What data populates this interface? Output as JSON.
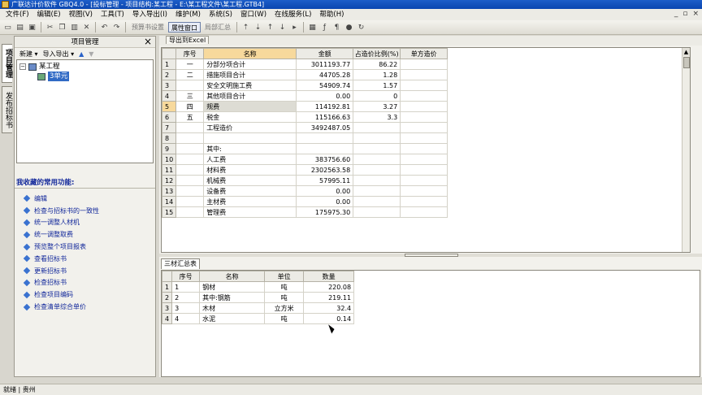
{
  "window": {
    "title": "广联达计价软件 GBQ4.0 - [投标管理 - 项目结构:某工程 - E:\\某工程文件\\某工程.GTB4]"
  },
  "menu": [
    "文件(F)",
    "编辑(E)",
    "视图(V)",
    "工具(T)",
    "导入导出(I)",
    "维护(M)",
    "系统(S)",
    "窗口(W)",
    "在线服务(L)",
    "帮助(H)"
  ],
  "toolbar": {
    "calc_settings": "预算书设置",
    "property_window": "属性窗口",
    "local_summary": "局部汇总"
  },
  "side_tabs": [
    "项目管理",
    "发布招标书"
  ],
  "left_panel": {
    "title": "项目管理",
    "tools": [
      "新建 ▾",
      "导入导出 ▾"
    ],
    "tree": {
      "root": "某工程",
      "child": "3单元"
    },
    "favorites_title": "我收藏的常用功能:",
    "favorites": [
      "编辑",
      "检查与招标书的一致性",
      "统一调整人材机",
      "统一调整取费",
      "预览整个项目报表",
      "查看招标书",
      "更新招标书",
      "检查招标书",
      "检查项目编码",
      "检查清单综合单价"
    ]
  },
  "main": {
    "export_tab": "导出到Excel",
    "top_headers": [
      "序号",
      "名称",
      "金额",
      "占造价比例(%)",
      "单方造价"
    ],
    "top_rows": [
      [
        "1",
        "一",
        "分部分项合计",
        "3011193.77",
        "86.22",
        ""
      ],
      [
        "2",
        "二",
        "措施项目合计",
        "44705.28",
        "1.28",
        ""
      ],
      [
        "3",
        "",
        "安全文明施工费",
        "54909.74",
        "1.57",
        ""
      ],
      [
        "4",
        "三",
        "其他项目合计",
        "0.00",
        "0",
        ""
      ],
      [
        "5",
        "四",
        "规费",
        "114192.81",
        "3.27",
        ""
      ],
      [
        "6",
        "五",
        "税金",
        "115166.63",
        "3.3",
        ""
      ],
      [
        "7",
        "",
        "工程造价",
        "3492487.05",
        "",
        ""
      ],
      [
        "8",
        "",
        "",
        "",
        "",
        ""
      ],
      [
        "9",
        "",
        "其中:",
        "",
        "",
        ""
      ],
      [
        "10",
        "",
        "人工费",
        "383756.60",
        "",
        ""
      ],
      [
        "11",
        "",
        "材料费",
        "2302563.58",
        "",
        ""
      ],
      [
        "12",
        "",
        "机械费",
        "57995.11",
        "",
        ""
      ],
      [
        "13",
        "",
        "设备费",
        "0.00",
        "",
        ""
      ],
      [
        "14",
        "",
        "主材费",
        "0.00",
        "",
        ""
      ],
      [
        "15",
        "",
        "管理费",
        "175975.30",
        "",
        ""
      ]
    ],
    "bottom_tab": "三材汇总表",
    "bottom_headers": [
      "序号",
      "名称",
      "单位",
      "数量"
    ],
    "bottom_rows": [
      [
        "1",
        "1",
        "钢材",
        "吨",
        "220.08"
      ],
      [
        "2",
        "2",
        "其中:钢筋",
        "吨",
        "219.11"
      ],
      [
        "3",
        "3",
        "木材",
        "立方米",
        "32.4"
      ],
      [
        "4",
        "4",
        "水泥",
        "吨",
        "0.14"
      ]
    ]
  },
  "status": {
    "text": "就绪 | 贵州"
  }
}
